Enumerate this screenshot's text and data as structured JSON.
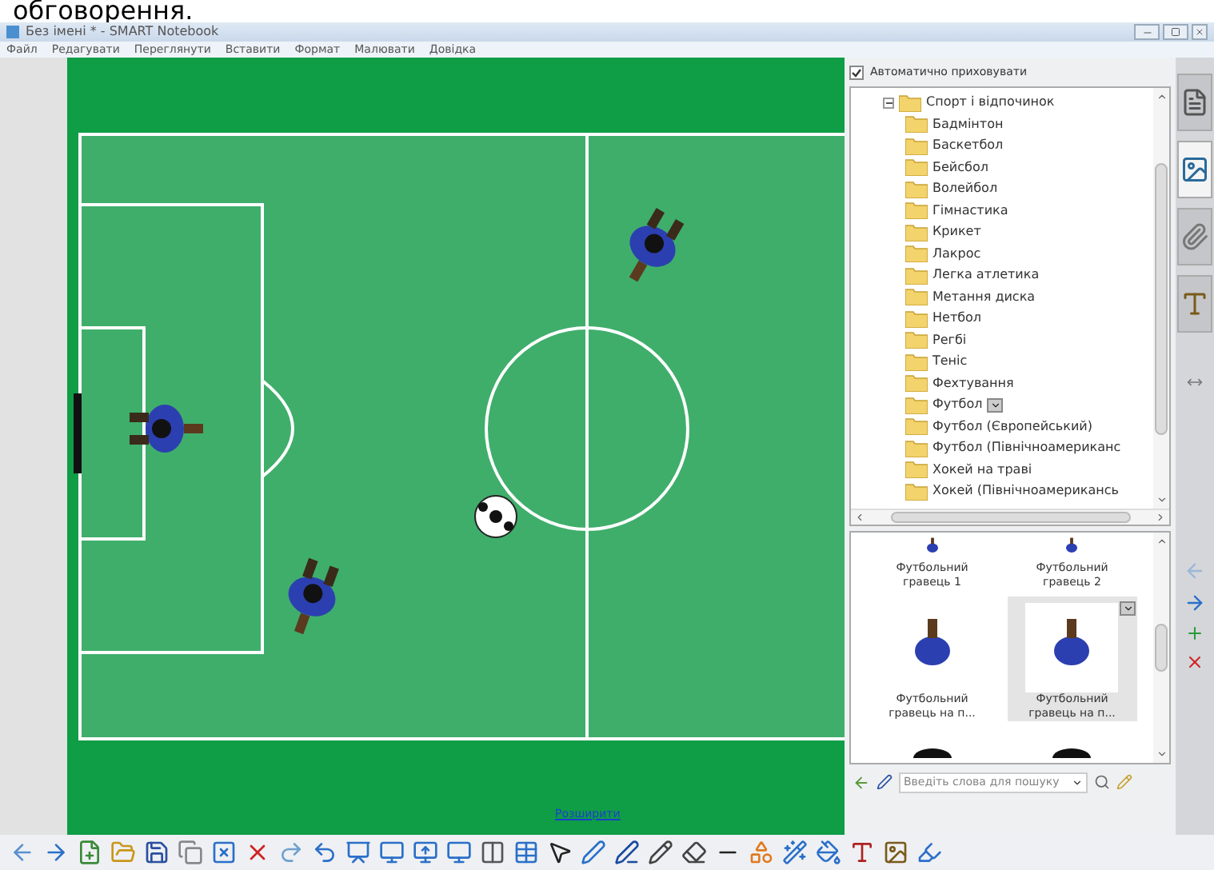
{
  "caption_fragment": "обговорення.",
  "window": {
    "title": "Без імені * - SMART Notebook"
  },
  "menu": [
    "Файл",
    "Редагувати",
    "Переглянути",
    "Вставити",
    "Формат",
    "Малювати",
    "Довідка"
  ],
  "canvas": {
    "expand_link": "Розширити"
  },
  "side_panel": {
    "auto_hide": {
      "label": "Автоматично приховувати",
      "checked": true
    },
    "tree": {
      "label": "Спорт і відпочинок",
      "expanded": true,
      "children": [
        {
          "label": "Бадмінтон",
          "has_menu": false
        },
        {
          "label": "Баскетбол",
          "has_menu": false
        },
        {
          "label": "Бейсбол",
          "has_menu": false
        },
        {
          "label": "Волейбол",
          "has_menu": false
        },
        {
          "label": "Гімнастика",
          "has_menu": false
        },
        {
          "label": "Крикет",
          "has_menu": false
        },
        {
          "label": "Лакрос",
          "has_menu": false
        },
        {
          "label": "Легка атлетика",
          "has_menu": false
        },
        {
          "label": "Метання диска",
          "has_menu": false
        },
        {
          "label": "Нетбол",
          "has_menu": false
        },
        {
          "label": "Регбі",
          "has_menu": false
        },
        {
          "label": "Теніс",
          "has_menu": false
        },
        {
          "label": "Фехтування",
          "has_menu": false
        },
        {
          "label": "Футбол",
          "has_menu": true
        },
        {
          "label": "Футбол (Європейський)",
          "has_menu": false
        },
        {
          "label": "Футбол (Північноамериканс",
          "has_menu": false
        },
        {
          "label": "Хокей на траві",
          "has_menu": false
        },
        {
          "label": "Хокей (Північноамерикансь",
          "has_menu": false
        }
      ]
    },
    "gallery": [
      {
        "label": "Футбольний гравець 1",
        "selected": false
      },
      {
        "label": "Футбольний гравець 2",
        "selected": false
      },
      {
        "label": "Футбольний гравець на п...",
        "selected": false
      },
      {
        "label": "Футбольний гравець на п...",
        "selected": true
      },
      {
        "selected": false
      },
      {
        "selected": false
      }
    ],
    "search": {
      "placeholder": "Введіть слова для пошуку"
    }
  },
  "side_tabs": [
    {
      "kind": "pages",
      "selected": false
    },
    {
      "kind": "gallery",
      "selected": true
    },
    {
      "kind": "attachments",
      "selected": false
    },
    {
      "kind": "properties",
      "selected": false
    }
  ]
}
